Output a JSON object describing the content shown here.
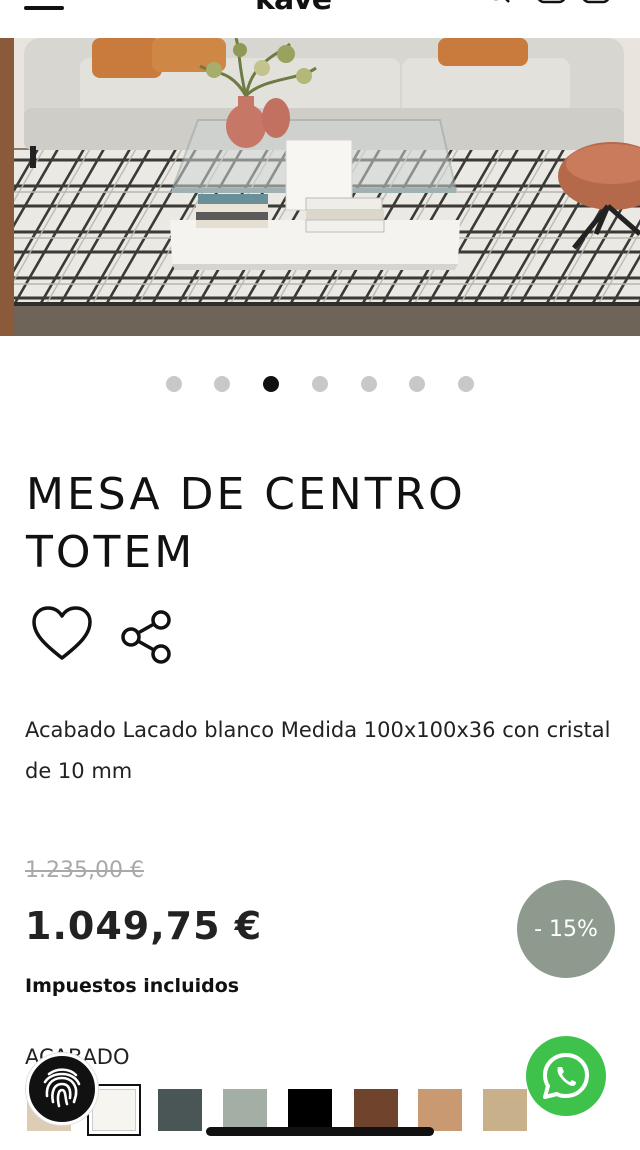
{
  "header": {
    "logo_text": "kave"
  },
  "gallery": {
    "slide_count": 7,
    "active_index": 2
  },
  "product": {
    "title": "MESA DE CENTRO TOTEM",
    "description": "Acabado Lacado blanco Medida 100x100x36 con cristal de 10 mm",
    "old_price": "1.235,00 €",
    "price": "1.049,75 €",
    "discount_badge": "- 15%",
    "tax_note": "Impuestos incluidos",
    "finish_label": "ACABADO"
  },
  "finishes": [
    {
      "color": "#dccdb4",
      "selected": false
    },
    {
      "color": "#f7f5ef",
      "selected": true
    },
    {
      "color": "#4a5556",
      "selected": false
    },
    {
      "color": "#a3aea5",
      "selected": false
    },
    {
      "color": "#000000",
      "selected": false
    },
    {
      "color": "#70432c",
      "selected": false
    },
    {
      "color": "#c99a72",
      "selected": false
    },
    {
      "color": "#c7b08a",
      "selected": false
    }
  ],
  "colors": {
    "discount_bg": "#8d9a8d",
    "whatsapp_green": "#3fc24c"
  },
  "icons": {
    "favorite": "heart-icon",
    "share": "share-icon",
    "menu": "menu-icon",
    "chat": "whatsapp-icon",
    "accessibility": "fingerprint-icon"
  }
}
